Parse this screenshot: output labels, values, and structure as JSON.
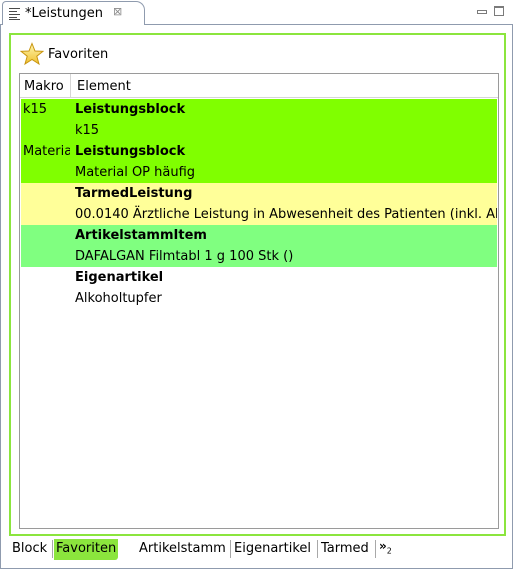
{
  "view": {
    "title": "*Leistungen",
    "close_glyph": "⊠"
  },
  "favorites": {
    "label": "Favoriten",
    "icon": "star-icon"
  },
  "table": {
    "headers": [
      "Makro",
      "Element"
    ],
    "rows": [
      {
        "macro": "k15",
        "type": "Leistungsblock",
        "name": "k15",
        "color": "#80ff00"
      },
      {
        "macro": "Materia",
        "type": "Leistungsblock",
        "name": "Material OP häufig",
        "color": "#80ff00"
      },
      {
        "macro": "",
        "type": "TarmedLeistung",
        "name": "00.0140 Ärztliche Leistung in Abwesenheit des Patienten (inkl. Ak",
        "color": "#ffff99"
      },
      {
        "macro": "",
        "type": "ArtikelstammItem",
        "name": "DAFALGAN Filmtabl 1 g 100 Stk ()",
        "color": "#80ff80"
      },
      {
        "macro": "",
        "type": "Eigenartikel",
        "name": "Alkoholtupfer",
        "color": "#ffffff"
      }
    ]
  },
  "bottom_tabs": [
    {
      "label": "Block",
      "active": false
    },
    {
      "label": "Favoriten",
      "active": true
    },
    {
      "label": "Artikelstamm",
      "active": false
    },
    {
      "label": "Eigenartikel",
      "active": false
    },
    {
      "label": "Tarmed",
      "active": false
    }
  ],
  "overflow": {
    "glyph": "»",
    "count": "2"
  },
  "colors": {
    "accent_green": "#8be53d",
    "row_block": "#80ff00",
    "row_tarmed": "#ffff99",
    "row_artikel": "#80ff80"
  }
}
